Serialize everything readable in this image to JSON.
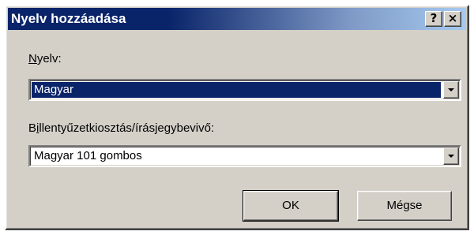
{
  "window": {
    "title": "Nyelv hozzáadása",
    "help_label": "?",
    "close_label": "×"
  },
  "language": {
    "label": "Nyelv:",
    "value": "Magyar",
    "selected": true
  },
  "keyboard_layout": {
    "label": "Billentyűzetkiosztás/írásjegybevivő:",
    "value": "Magyar 101 gombos"
  },
  "buttons": {
    "ok_label": "OK",
    "cancel_label": "Mégse"
  },
  "colors": {
    "dialog_face": "#d4d0c8",
    "title_active": "#0a246a",
    "selection": "#0a246a"
  }
}
